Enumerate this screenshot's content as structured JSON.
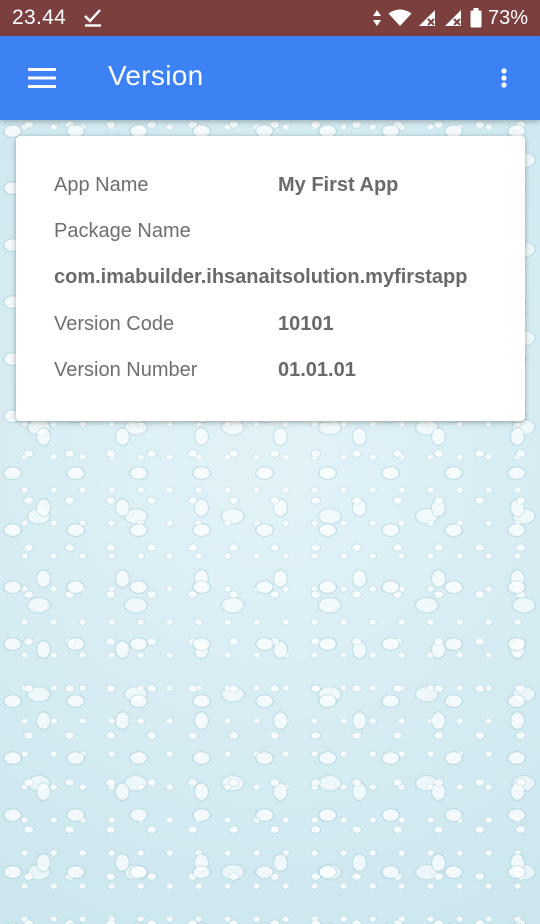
{
  "status_bar": {
    "time": "23.44",
    "battery_percent": "73%",
    "icons": [
      "download-done-icon",
      "data-arrows-icon",
      "wifi-icon",
      "signal-x-icon",
      "signal-x-icon",
      "battery-icon"
    ],
    "background": "#7b3f3e"
  },
  "app_bar": {
    "title": "Version",
    "menu_icon": "hamburger-menu-icon",
    "overflow_icon": "more-vertical-icon",
    "color": "#3d82f5"
  },
  "card": {
    "app_name_label": "App Name",
    "app_name_value": "My First App",
    "package_name_label": "Package Name",
    "package_name_value": "com.imabuilder.ihsanaitsolution.myfirstapp",
    "version_code_label": "Version Code",
    "version_code_value": "10101",
    "version_number_label": "Version Number",
    "version_number_value": "01.01.01"
  }
}
